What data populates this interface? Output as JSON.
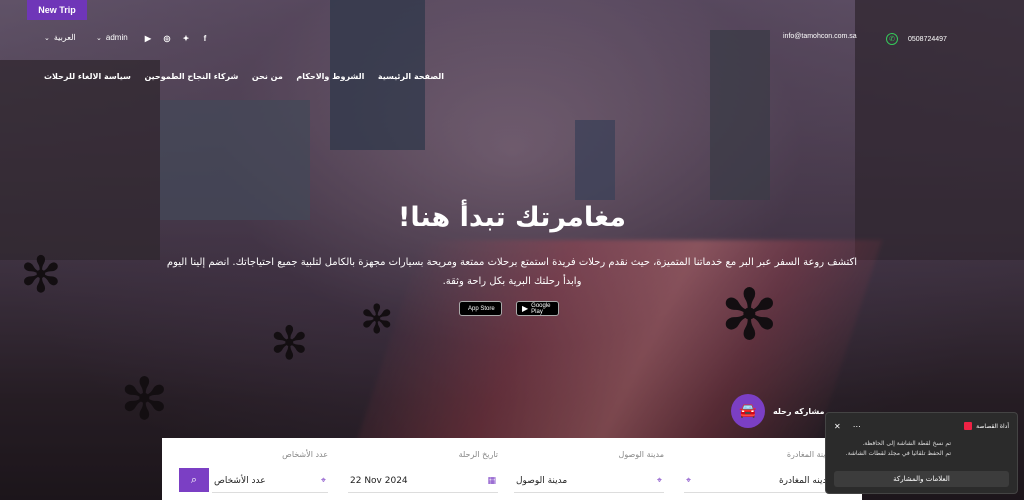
{
  "header": {
    "new_trip": "New Trip",
    "language": "العربية",
    "user": "admin",
    "email": "info@tamohcon.com.sa",
    "phone": "0508724497"
  },
  "nav": {
    "items": [
      "الصفحة الرئيسية",
      "الشروط والاحكام",
      "من نحن",
      "شركاء النجاح الطموحين",
      "سياسة الالغاء للرحلات"
    ]
  },
  "hero": {
    "title": "مغامرتك تبدأ هنا!",
    "description": "اكتشف روعة السفر عبر البر مع خدماتنا المتميزة، حيث نقدم رحلات فريدة استمتع برحلات ممتعة ومريحة بسيارات مجهزة بالكامل لتلبية جميع احتياجاتك. انضم إلينا اليوم وابدأ رحلتك البرية بكل راحة وثقة.",
    "app_store": "App Store",
    "google_play": "Google Play"
  },
  "share": {
    "label": "مشاركه رحله"
  },
  "search": {
    "departure_label": "مدينة المغادرة",
    "departure_value": "مدينه المغادرة",
    "arrival_label": "مدينة الوصول",
    "arrival_value": "مدينة الوصول",
    "date_label": "تاريخ الرحلة",
    "date_value": "22 Nov 2024",
    "persons_label": "عدد الأشخاص",
    "persons_value": "عدد الأشخاص"
  },
  "toast": {
    "title": "أداة القصاصة",
    "line1": "تم نسخ لقطة الشاشة إلى الحافظة.",
    "line2": "تم الحفظ تلقائيا في مجلد لقطات الشاشة.",
    "button": "العلامات والمشاركة"
  },
  "colors": {
    "accent": "#7b3fc4",
    "whatsapp": "#35c95a"
  }
}
